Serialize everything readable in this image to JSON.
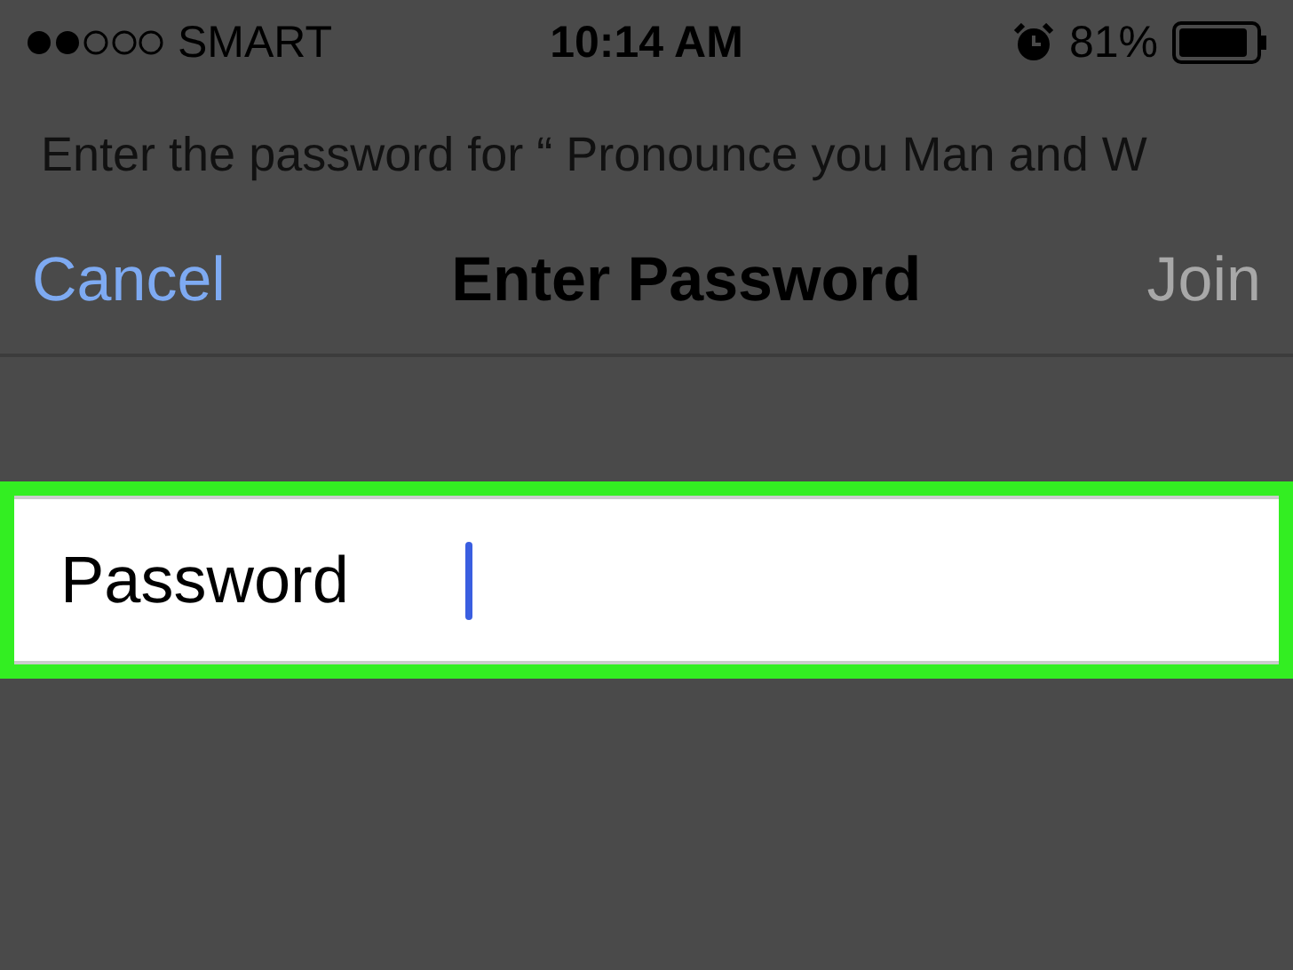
{
  "status_bar": {
    "carrier": "SMART",
    "time": "10:14 AM",
    "battery_percent": "81%"
  },
  "prompt": "Enter the password for “ Pronounce you Man and W",
  "nav": {
    "cancel": "Cancel",
    "title": "Enter Password",
    "join": {
      "label": "Join",
      "disabled": true
    }
  },
  "password_field": {
    "label": "Password",
    "highlighted": true
  }
}
